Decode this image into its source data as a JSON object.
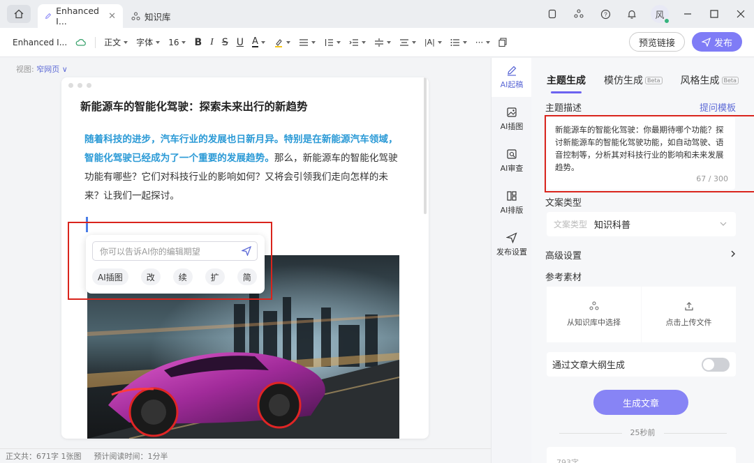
{
  "titlebar": {
    "tabs": [
      {
        "label": "Enhanced I...",
        "active": true
      },
      {
        "label": "知识库",
        "active": false
      }
    ],
    "avatar_text": "风"
  },
  "toolbar": {
    "doc_name": "Enhanced I...",
    "style_label": "正文",
    "font_label": "字体",
    "size_label": "16",
    "preview_label": "预览链接",
    "publish_label": "发布"
  },
  "editor": {
    "view_label": "视图:",
    "view_value": "窄网页",
    "title": "新能源车的智能化驾驶：探索未来出行的新趋势",
    "para_highlight": "随着科技的进步，汽车行业的发展也日新月异。特别是在新能源汽车领域，智能化驾驶已经成为了一个重要的发展趋势。",
    "para_rest": "那么，新能源车的智能化驾驶功能有哪些？它们对科技行业的影响如何？又将会引领我们走向怎样的未来？让我们一起探讨。",
    "ai_input_placeholder": "你可以告诉AI你的编辑期望",
    "ai_chips": [
      "AI插图",
      "改",
      "续",
      "扩",
      "简"
    ]
  },
  "statusbar": {
    "word_count": "正文共：671字  1张图",
    "read_time": "预计阅读时间：1分半"
  },
  "side_strip": {
    "items": [
      {
        "label": "AI起稿",
        "icon": "pen-icon",
        "active": true
      },
      {
        "label": "AI插图",
        "icon": "image-icon",
        "active": false
      },
      {
        "label": "AI审查",
        "icon": "review-icon",
        "active": false
      },
      {
        "label": "AI排版",
        "icon": "layout-icon",
        "active": false
      },
      {
        "label": "发布设置",
        "icon": "send-icon",
        "active": false
      }
    ]
  },
  "panel": {
    "tabs": [
      {
        "label": "主题生成",
        "beta": false,
        "active": true
      },
      {
        "label": "模仿生成",
        "beta": true,
        "active": false
      },
      {
        "label": "风格生成",
        "beta": true,
        "active": false
      }
    ],
    "beta_label": "Beta",
    "topic_label": "主题描述",
    "template_link": "提问模板",
    "topic_text": "新能源车的智能化驾驶：你最期待哪个功能？探讨新能源车的智能化驾驶功能，如自动驾驶、语音控制等，分析其对科技行业的影响和未来发展趋势。",
    "topic_count": "67 / 300",
    "copy_type_label": "文案类型",
    "copy_type_placeholder": "文案类型",
    "copy_type_value": "知识科普",
    "advanced_label": "高级设置",
    "reference_label": "参考素材",
    "from_kb_label": "从知识库中选择",
    "upload_label": "点击上传文件",
    "outline_label": "通过文章大纲生成",
    "generate_label": "生成文章",
    "time_ago": "25秒前",
    "history_preview": "793字"
  },
  "colors": {
    "accent": "#7f7cf6",
    "highlight_text": "#2b9ad6",
    "annotation_red": "#d9241c"
  }
}
